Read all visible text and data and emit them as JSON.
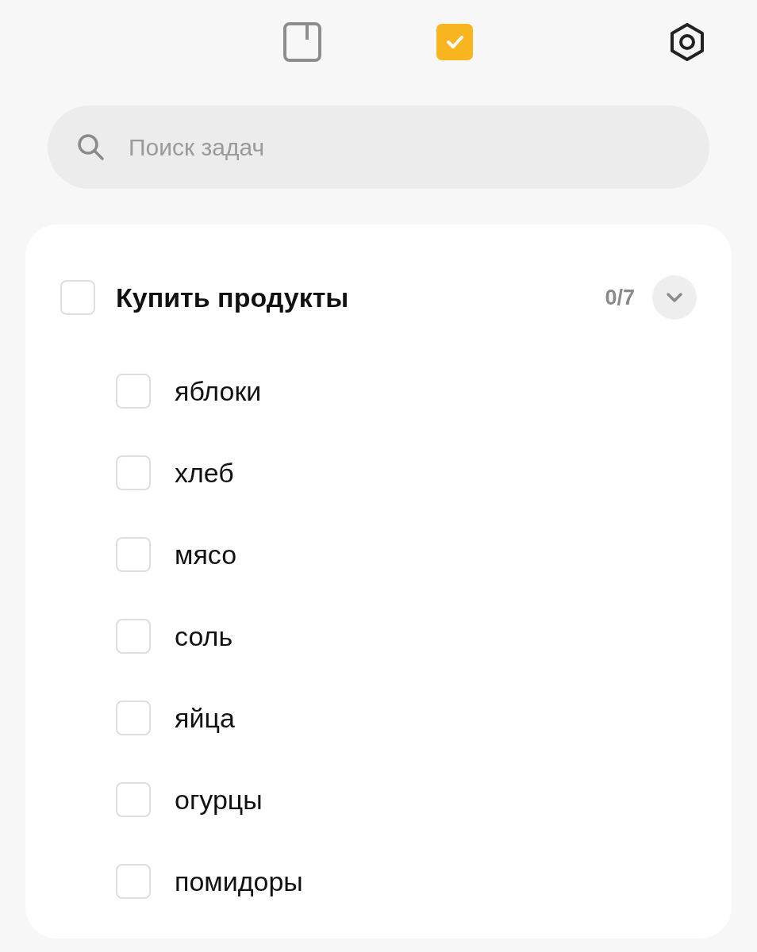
{
  "tabs": [
    {
      "kind": "notes",
      "selected": false
    },
    {
      "kind": "tasks",
      "selected": true
    }
  ],
  "search": {
    "placeholder": "Поиск задач"
  },
  "group": {
    "title": "Купить продукты",
    "checked": false,
    "count": "0/7",
    "expanded": true,
    "items": [
      {
        "text": "яблоки",
        "checked": false
      },
      {
        "text": "хлеб",
        "checked": false
      },
      {
        "text": "мясо",
        "checked": false
      },
      {
        "text": "соль",
        "checked": false
      },
      {
        "text": "яйца",
        "checked": false
      },
      {
        "text": "огурцы",
        "checked": false
      },
      {
        "text": "помидоры",
        "checked": false
      }
    ]
  }
}
